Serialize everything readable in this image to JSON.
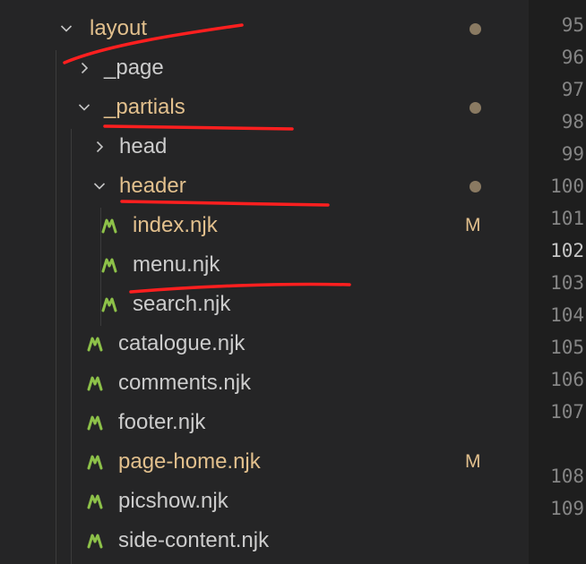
{
  "tree": {
    "rows": [
      {
        "name": "layout",
        "kind": "folder",
        "expanded": true,
        "modified": true,
        "status": "dot"
      },
      {
        "name": "_page",
        "kind": "folder",
        "expanded": false,
        "modified": false,
        "status": ""
      },
      {
        "name": "_partials",
        "kind": "folder",
        "expanded": true,
        "modified": true,
        "status": "dot"
      },
      {
        "name": "head",
        "kind": "folder",
        "expanded": false,
        "modified": false,
        "status": ""
      },
      {
        "name": "header",
        "kind": "folder",
        "expanded": true,
        "modified": true,
        "status": "dot"
      },
      {
        "name": "index.njk",
        "kind": "file",
        "modified": true,
        "status": "M"
      },
      {
        "name": "menu.njk",
        "kind": "file",
        "modified": false,
        "status": ""
      },
      {
        "name": "search.njk",
        "kind": "file",
        "modified": false,
        "status": ""
      },
      {
        "name": "catalogue.njk",
        "kind": "file",
        "modified": false,
        "status": ""
      },
      {
        "name": "comments.njk",
        "kind": "file",
        "modified": false,
        "status": ""
      },
      {
        "name": "footer.njk",
        "kind": "file",
        "modified": false,
        "status": ""
      },
      {
        "name": "page-home.njk",
        "kind": "file",
        "modified": true,
        "status": "M"
      },
      {
        "name": "picshow.njk",
        "kind": "file",
        "modified": false,
        "status": ""
      },
      {
        "name": "side-content.njk",
        "kind": "file",
        "modified": false,
        "status": ""
      }
    ]
  },
  "gutter": {
    "line_numbers": [
      "95",
      "96",
      "97",
      "98",
      "99",
      "100",
      "101",
      "102",
      "103",
      "104",
      "105",
      "106",
      "107",
      "108",
      "109"
    ],
    "active_line": "102"
  },
  "colors": {
    "modified_text": "#e2c08d",
    "njk_icon": "#8dc149",
    "annotation": "#ff1f1f"
  },
  "icons": {
    "expanded": "chevron-down-icon",
    "collapsed": "chevron-right-icon",
    "njk_file": "nunjucks-file-icon",
    "modified_dot": "dot-icon"
  }
}
